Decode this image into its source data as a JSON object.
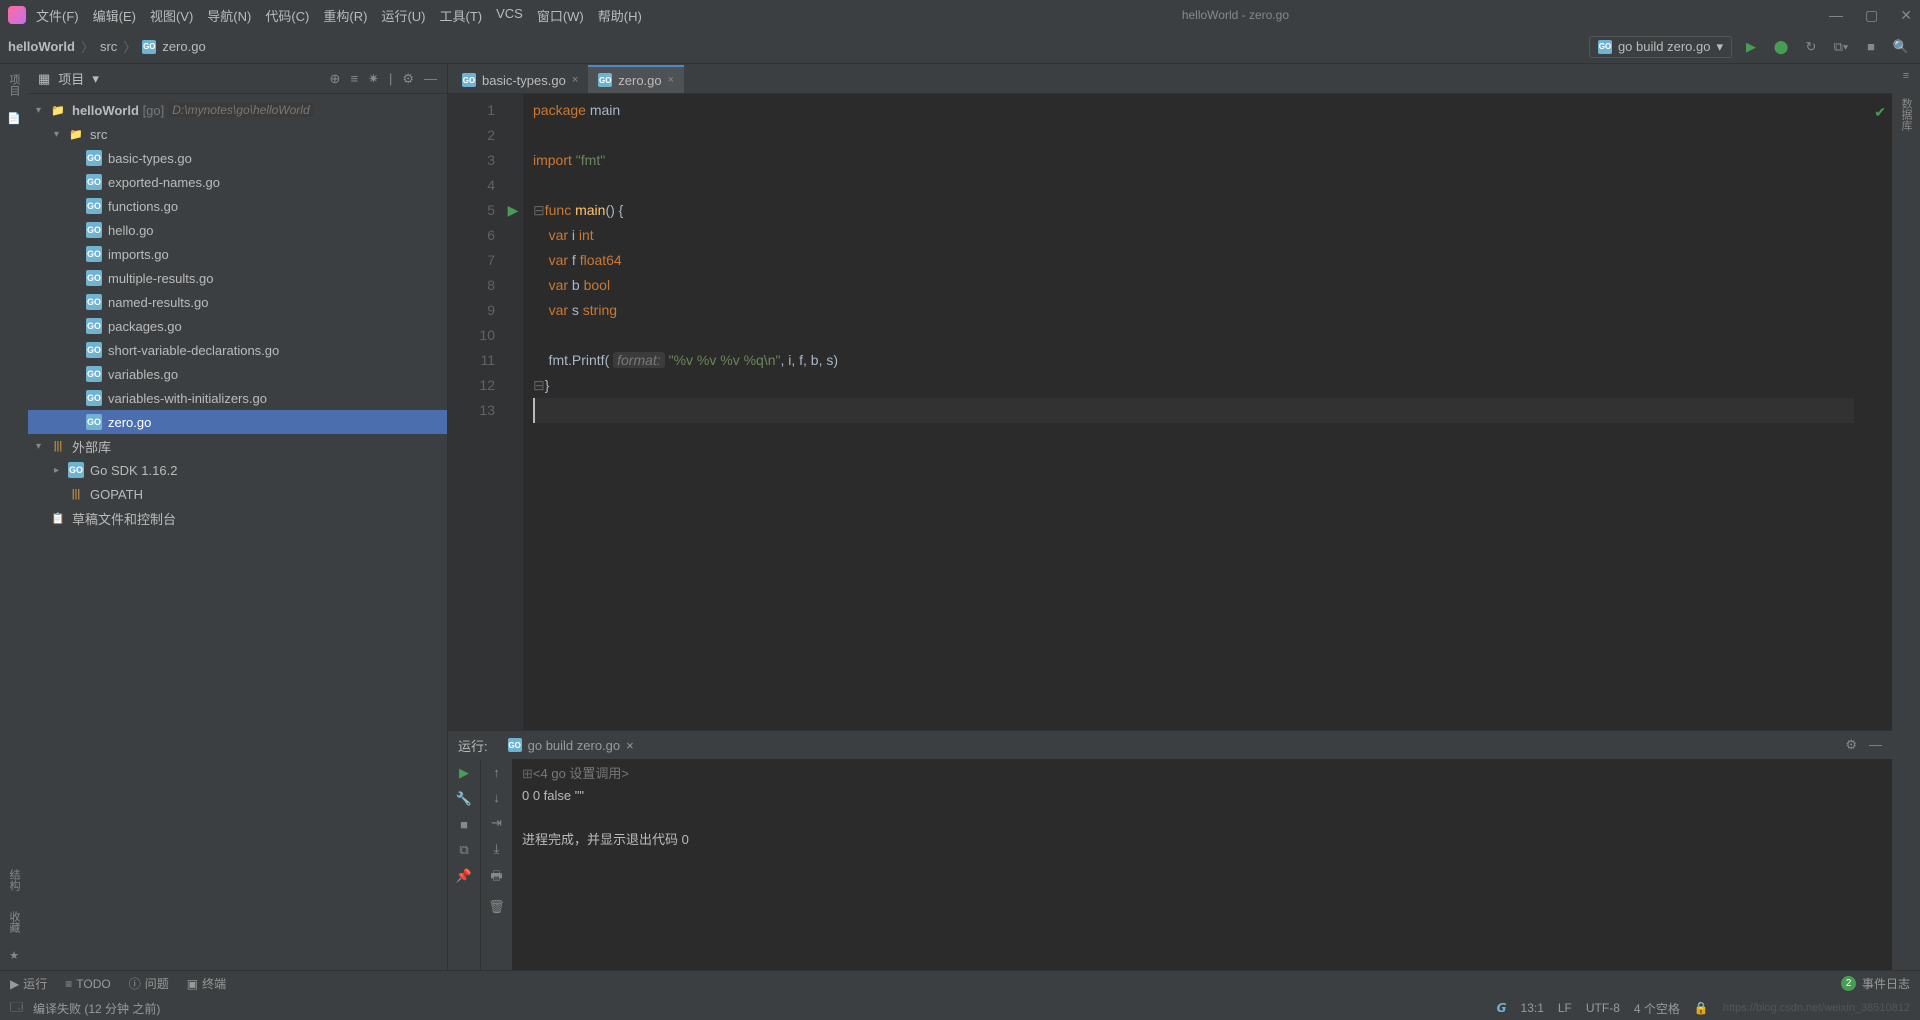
{
  "titlebar": {
    "menus": [
      "文件(F)",
      "编辑(E)",
      "视图(V)",
      "导航(N)",
      "代码(C)",
      "重构(R)",
      "运行(U)",
      "工具(T)",
      "VCS",
      "窗口(W)",
      "帮助(H)"
    ],
    "title": "helloWorld - zero.go"
  },
  "breadcrumb": [
    "helloWorld",
    "src",
    "zero.go"
  ],
  "run_config": "go build zero.go",
  "project_panel": {
    "title": "项目",
    "root_name": "helloWorld",
    "root_tag": "[go]",
    "root_path": "D:\\mynotes\\go\\helloWorld",
    "src_folder": "src",
    "files": [
      "basic-types.go",
      "exported-names.go",
      "functions.go",
      "hello.go",
      "imports.go",
      "multiple-results.go",
      "named-results.go",
      "packages.go",
      "short-variable-declarations.go",
      "variables.go",
      "variables-with-initializers.go",
      "zero.go"
    ],
    "ext_lib": "外部库",
    "go_sdk": "Go SDK 1.16.2",
    "gopath": "GOPATH <go>",
    "scratch": "草稿文件和控制台"
  },
  "tabs": [
    {
      "name": "basic-types.go",
      "active": false
    },
    {
      "name": "zero.go",
      "active": true
    }
  ],
  "code": {
    "lines": [
      {
        "n": 1,
        "html": "<span class='kw'>package</span> <span class='id'>main</span>"
      },
      {
        "n": 2,
        "html": ""
      },
      {
        "n": 3,
        "html": "<span class='kw'>import</span> <span class='str'>\"fmt\"</span>"
      },
      {
        "n": 4,
        "html": ""
      },
      {
        "n": 5,
        "html": "<span class='fold-marker'>⊟</span><span class='kw'>func</span> <span class='fn'>main</span>() {",
        "play": true
      },
      {
        "n": 6,
        "html": "    <span class='kw'>var</span> i <span class='typ'>int</span>"
      },
      {
        "n": 7,
        "html": "    <span class='kw'>var</span> f <span class='typ'>float64</span>"
      },
      {
        "n": 8,
        "html": "    <span class='kw'>var</span> b <span class='typ'>bool</span>"
      },
      {
        "n": 9,
        "html": "    <span class='kw'>var</span> s <span class='typ'>string</span>"
      },
      {
        "n": 10,
        "html": ""
      },
      {
        "n": 11,
        "html": "    fmt.Printf( <span class='hint'>format:</span> <span class='str'>\"%v %v %v %q\\n\"</span>, i, f, b, s)"
      },
      {
        "n": 12,
        "html": "<span class='fold-marker'>⊟</span>}"
      },
      {
        "n": 13,
        "html": "",
        "current": true
      }
    ]
  },
  "run_panel": {
    "label": "运行:",
    "tab": "go build zero.go",
    "cmd_prefix": "<4 go 设置调用>",
    "output": "0 0 false \"\"",
    "exit": "进程完成，并显示退出代码 0"
  },
  "tool_bar": {
    "items": [
      "运行",
      "TODO",
      "问题",
      "终端"
    ],
    "event_count": "2",
    "event_label": "事件日志"
  },
  "statusbar": {
    "msg": "编译失败 (12 分钟 之前)",
    "pos": "13:1",
    "enc": "LF",
    "charset": "UTF-8",
    "spaces": "4 个空格",
    "watermark": "https://blog.csdn.net/weixin_38510812"
  },
  "left_gutter": {
    "top": "项目",
    "structure": "结构",
    "fav": "收藏"
  },
  "right_gutter": {
    "top": "数据库"
  }
}
